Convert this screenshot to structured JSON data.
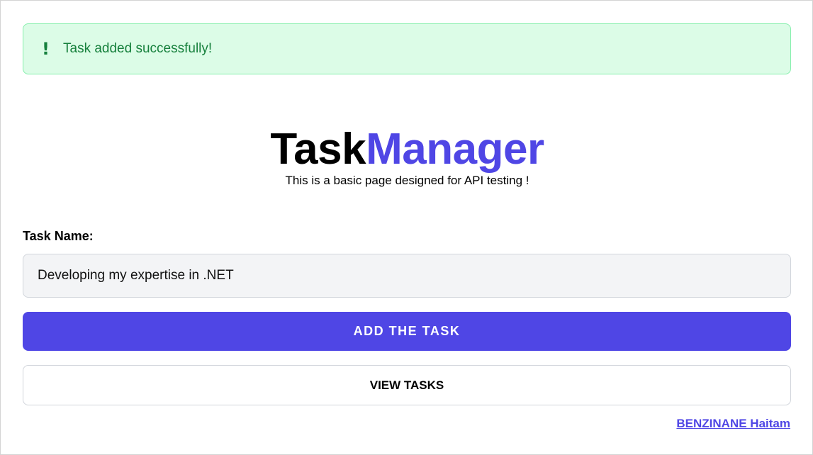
{
  "alert": {
    "icon": "exclamation-icon",
    "message": "Task added successfully!"
  },
  "header": {
    "title_part1": "Task",
    "title_part2": "Manager",
    "subtitle": "This is a basic page designed for API testing !"
  },
  "form": {
    "task_label": "Task Name:",
    "task_value": "Developing my expertise in .NET",
    "add_button": "ADD THE TASK",
    "view_button": "VIEW TASKS"
  },
  "footer": {
    "author_link": "BENZINANE Haitam"
  },
  "colors": {
    "accent": "#4f46e5",
    "success_bg": "#dcfce7",
    "success_text": "#15803d"
  }
}
